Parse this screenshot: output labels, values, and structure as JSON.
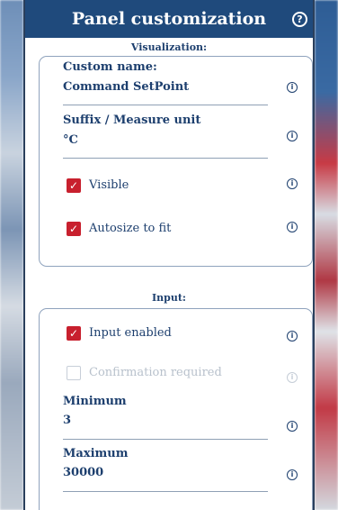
{
  "header": {
    "title": "Panel customization",
    "help_icon": "question-circle-icon",
    "help_glyph": "?"
  },
  "visualization": {
    "section_title": "Visualization:",
    "custom_name": {
      "label": "Custom name:",
      "value": "Command SetPoint"
    },
    "suffix": {
      "label": "Suffix / Measure unit",
      "value": "°C"
    },
    "visible": {
      "label": "Visible",
      "checked": true
    },
    "autosize": {
      "label": "Autosize to fit",
      "checked": true
    }
  },
  "input": {
    "section_title": "Input:",
    "input_enabled": {
      "label": "Input enabled",
      "checked": true
    },
    "confirmation": {
      "label": "Confirmation required",
      "checked": false,
      "disabled": true
    },
    "minimum": {
      "label": "Minimum",
      "value": "3"
    },
    "maximum": {
      "label": "Maximum",
      "value": "30000"
    }
  },
  "icons": {
    "info_glyph": "i",
    "check_glyph": "✓"
  },
  "colors": {
    "header_bg": "#1f4a7c",
    "accent_red": "#c8202e",
    "text": "#1d3f6e"
  }
}
